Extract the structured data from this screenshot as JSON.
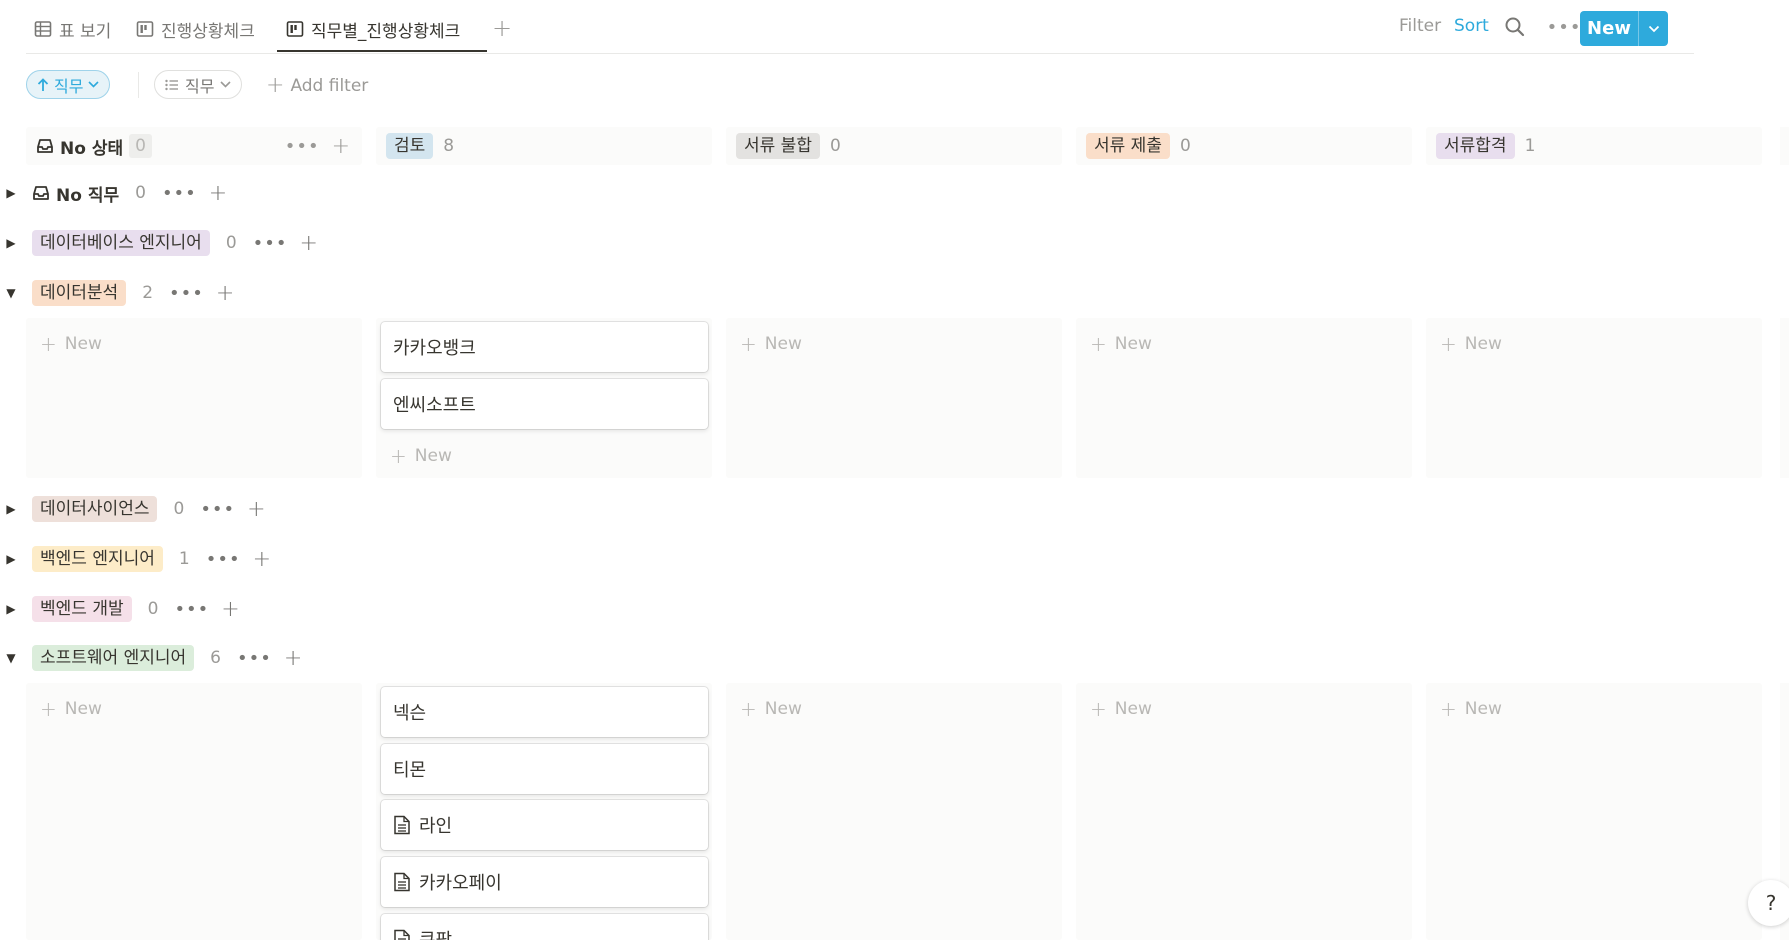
{
  "views": {
    "tabs": [
      {
        "label": "표 보기",
        "icon": "table-icon"
      },
      {
        "label": "진행상황체크",
        "icon": "board-icon"
      },
      {
        "label": "직무별_진행상황체크",
        "icon": "board-icon",
        "active": true
      }
    ],
    "add_view": "+"
  },
  "toolbar": {
    "filter_label": "Filter",
    "sort_label": "Sort",
    "more": "•••",
    "new_label": "New"
  },
  "filters": {
    "sort_chip": "직무",
    "group_chip": "직무",
    "add_filter": "Add filter"
  },
  "columns": [
    {
      "label": "No 상태",
      "count": "0"
    },
    {
      "label": "검토",
      "count": "8",
      "color": "#d3e5ef"
    },
    {
      "label": "서류 불합",
      "count": "0",
      "color": "#e3e2e0"
    },
    {
      "label": "서류 제출",
      "count": "0",
      "color": "#fadec9"
    },
    {
      "label": "서류합격",
      "count": "1",
      "color": "#e8deee"
    }
  ],
  "groups": [
    {
      "label": "No 직무",
      "count": "0",
      "expanded": false
    },
    {
      "label": "데이터베이스 엔지니어",
      "count": "0",
      "expanded": false,
      "color": "#e8deee"
    },
    {
      "label": "데이터분석",
      "count": "2",
      "expanded": true,
      "color": "#fadec9",
      "cards": [
        "카카오뱅크",
        "엔씨소프트"
      ]
    },
    {
      "label": "데이터사이언스",
      "count": "0",
      "expanded": false,
      "color": "#eee0da"
    },
    {
      "label": "백엔드 엔지니어",
      "count": "1",
      "expanded": false,
      "color": "#fdecc8"
    },
    {
      "label": "벡엔드 개발",
      "count": "0",
      "expanded": false,
      "color": "#f5e0e9"
    },
    {
      "label": "소프트웨어 엔지니어",
      "count": "6",
      "expanded": true,
      "color": "#dbeddb",
      "cards": [
        "넥슨",
        "티몬",
        "라인",
        "카카오페이",
        "쿠팡"
      ]
    }
  ],
  "new_label": "New",
  "help": "?"
}
